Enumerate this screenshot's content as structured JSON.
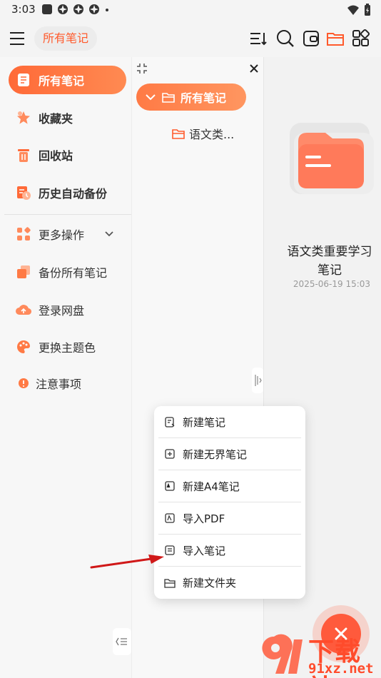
{
  "status": {
    "time": "3:03"
  },
  "topbar": {
    "chip_label": "所有笔记"
  },
  "sidebar": {
    "items": [
      {
        "label": "所有笔记"
      },
      {
        "label": "收藏夹"
      },
      {
        "label": "回收站"
      },
      {
        "label": "历史自动备份"
      },
      {
        "label": "更多操作"
      },
      {
        "label": "备份所有笔记"
      },
      {
        "label": "登录网盘"
      },
      {
        "label": "更换主题色"
      },
      {
        "label": "注意事项"
      }
    ]
  },
  "folders": {
    "root_label": "所有笔记",
    "sub_label": "语文类..."
  },
  "note": {
    "title": "语文类重要学习笔记",
    "date": "2025-06-19 15:03"
  },
  "popup": {
    "items": [
      {
        "label": "新建笔记"
      },
      {
        "label": "新建无界笔记"
      },
      {
        "label": "新建A4笔记"
      },
      {
        "label": "导入PDF"
      },
      {
        "label": "导入笔记"
      },
      {
        "label": "新建文件夹"
      }
    ]
  },
  "watermark": {
    "line1": "下载站",
    "line2": "91xz.net"
  },
  "colors": {
    "accent": "#ff6a38",
    "fab": "#ff5a3c",
    "arrow": "#d01818"
  }
}
